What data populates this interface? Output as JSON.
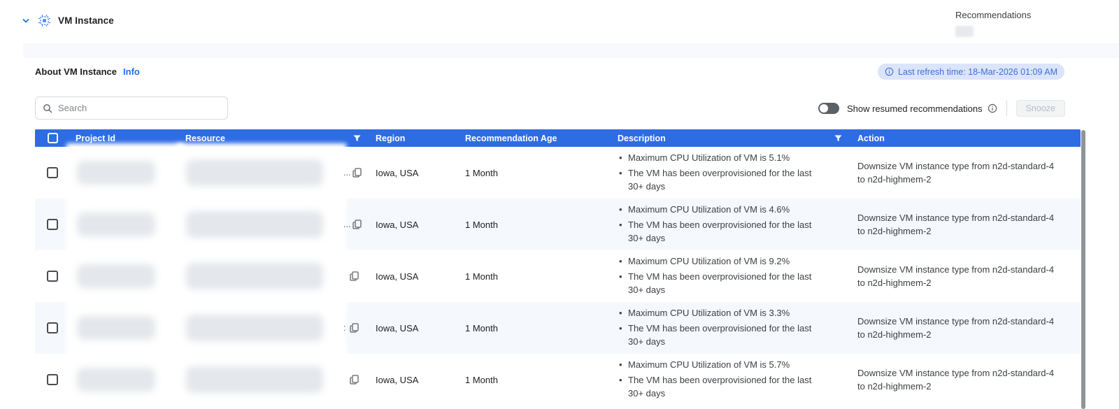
{
  "header": {
    "title": "VM Instance",
    "recommendations_label": "Recommendations"
  },
  "about": {
    "label": "About VM Instance",
    "info_link": "Info"
  },
  "refresh_badge": {
    "text": "Last refresh time: 18-Mar-2026 01:09 AM"
  },
  "toolbar": {
    "search_placeholder": "Search",
    "show_resumed_label": "Show resumed recommendations",
    "snooze_label": "Snooze"
  },
  "table": {
    "columns": [
      "Project Id",
      "Resource",
      "Region",
      "Recommendation Age",
      "Description",
      "Action"
    ],
    "rows": [
      {
        "project_id_redacted": true,
        "resource_redacted": true,
        "resource_suffix": "...",
        "region": "Iowa, USA",
        "age": "1 Month",
        "description": [
          "Maximum CPU Utilization of VM is 5.1%",
          "The VM has been overprovisioned for the last 30+ days"
        ],
        "action": "Downsize VM instance type from n2d-standard-4 to n2d-highmem-2"
      },
      {
        "project_id_redacted": true,
        "resource_redacted": true,
        "resource_suffix": "...",
        "region": "Iowa, USA",
        "age": "1 Month",
        "description": [
          "Maximum CPU Utilization of VM is 4.6%",
          "The VM has been overprovisioned for the last 30+ days"
        ],
        "action": "Downsize VM instance type from n2d-standard-4 to n2d-highmem-2"
      },
      {
        "project_id_redacted": true,
        "resource_redacted": true,
        "resource_suffix": "",
        "region": "Iowa, USA",
        "age": "1 Month",
        "description": [
          "Maximum CPU Utilization of VM is 9.2%",
          "The VM has been overprovisioned for the last 30+ days"
        ],
        "action": "Downsize VM instance type from n2d-standard-4 to n2d-highmem-2"
      },
      {
        "project_id_redacted": true,
        "resource_redacted": true,
        "resource_suffix": ":",
        "region": "Iowa, USA",
        "age": "1 Month",
        "description": [
          "Maximum CPU Utilization of VM is 3.3%",
          "The VM has been overprovisioned for the last 30+ days"
        ],
        "action": "Downsize VM instance type from n2d-standard-4 to n2d-highmem-2"
      },
      {
        "project_id_redacted": true,
        "resource_redacted": true,
        "resource_suffix": "",
        "region": "Iowa, USA",
        "age": "1 Month",
        "description": [
          "Maximum CPU Utilization of VM is 5.7%",
          "The VM has been overprovisioned for the last 30+ days"
        ],
        "action": "Downsize VM instance type from n2d-standard-4 to n2d-highmem-2"
      }
    ]
  },
  "colors": {
    "table_header_blue": "#2e6ce4",
    "link_blue": "#1a73e8",
    "icon_blue": "#4285f4",
    "badge_bg": "#dbe4f9",
    "badge_text": "#3d6edb",
    "row_stripe": "#f5f8fc",
    "toggle_track_off": "#5c6166",
    "scrollbar_thumb": "#8f949a"
  }
}
